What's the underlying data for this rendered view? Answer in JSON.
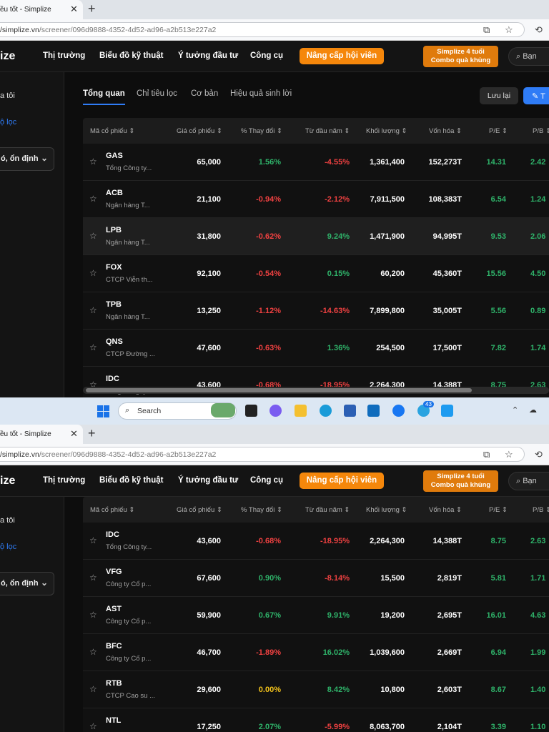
{
  "browser": {
    "tab_title": "ều tốt - Simplize",
    "tab_close": "✕",
    "new_tab": "+",
    "url_host": "/simplize.vn",
    "url_path": "/screener/096d9888-4352-4d52-ad96-a2b513e227a2"
  },
  "header": {
    "logo": "ize",
    "nav": [
      "Thị trường",
      "Biểu đồ kỹ thuật",
      "Ý tưởng đầu tư",
      "Công cụ"
    ],
    "upgrade": "Nâng cấp hội viên",
    "promo_line1": "Simplize 4 tuổi",
    "promo_line2": "Combo quà khủng",
    "search": "Bạn"
  },
  "sidebar": {
    "title": "a tôi",
    "link": "ộ lọc",
    "dropdown": "ó, ổn định"
  },
  "tabs": [
    "Tổng quan",
    "Chỉ tiêu lọc",
    "Cơ bản",
    "Hiệu quả sinh lời"
  ],
  "buttons": {
    "save": "Lưu lại",
    "create": "T"
  },
  "columns": [
    "Mã cổ phiếu ⇕",
    "Giá cổ phiếu ⇕",
    "% Thay đổi ⇕",
    "Từ đầu năm ⇕",
    "Khối lượng ⇕",
    "Vốn hóa ⇕",
    "P/E ⇕",
    "P/B ⇕"
  ],
  "rows_top": [
    {
      "sym": "GAS",
      "name": "Tổng Công ty...",
      "price": "65,000",
      "chg": "1.56%",
      "ytd": "-4.55%",
      "vol": "1,361,400",
      "cap": "152,273T",
      "pe": "14.31",
      "pb": "2.42"
    },
    {
      "sym": "ACB",
      "name": "Ngân hàng T...",
      "price": "21,100",
      "chg": "-0.94%",
      "ytd": "-2.12%",
      "vol": "7,911,500",
      "cap": "108,383T",
      "pe": "6.54",
      "pb": "1.24"
    },
    {
      "sym": "LPB",
      "name": "Ngân hàng T...",
      "price": "31,800",
      "chg": "-0.62%",
      "ytd": "9.24%",
      "vol": "1,471,900",
      "cap": "94,995T",
      "pe": "9.53",
      "pb": "2.06"
    },
    {
      "sym": "FOX",
      "name": "CTCP Viễn th...",
      "price": "92,100",
      "chg": "-0.54%",
      "ytd": "0.15%",
      "vol": "60,200",
      "cap": "45,360T",
      "pe": "15.56",
      "pb": "4.50"
    },
    {
      "sym": "TPB",
      "name": "Ngân hàng T...",
      "price": "13,250",
      "chg": "-1.12%",
      "ytd": "-14.63%",
      "vol": "7,899,800",
      "cap": "35,005T",
      "pe": "5.56",
      "pb": "0.89"
    },
    {
      "sym": "QNS",
      "name": "CTCP Đường ...",
      "price": "47,600",
      "chg": "-0.63%",
      "ytd": "1.36%",
      "vol": "254,500",
      "cap": "17,500T",
      "pe": "7.82",
      "pb": "1.74"
    },
    {
      "sym": "IDC",
      "name": "Tổng Công ty...",
      "price": "43,600",
      "chg": "-0.68%",
      "ytd": "-18.95%",
      "vol": "2,264,300",
      "cap": "14,388T",
      "pe": "8.75",
      "pb": "2.63"
    }
  ],
  "rows_bottom": [
    {
      "sym": "IDC",
      "name": "Tổng Công ty...",
      "price": "43,600",
      "chg": "-0.68%",
      "ytd": "-18.95%",
      "vol": "2,264,300",
      "cap": "14,388T",
      "pe": "8.75",
      "pb": "2.63"
    },
    {
      "sym": "VFG",
      "name": "Công ty Cổ p...",
      "price": "67,600",
      "chg": "0.90%",
      "ytd": "-8.14%",
      "vol": "15,500",
      "cap": "2,819T",
      "pe": "5.81",
      "pb": "1.71"
    },
    {
      "sym": "AST",
      "name": "Công ty Cổ p...",
      "price": "59,900",
      "chg": "0.67%",
      "ytd": "9.91%",
      "vol": "19,200",
      "cap": "2,695T",
      "pe": "16.01",
      "pb": "4.63"
    },
    {
      "sym": "BFC",
      "name": "Công ty Cổ p...",
      "price": "46,700",
      "chg": "-1.89%",
      "ytd": "16.02%",
      "vol": "1,039,600",
      "cap": "2,669T",
      "pe": "6.94",
      "pb": "1.99"
    },
    {
      "sym": "RTB",
      "name": "CTCP Cao su ...",
      "price": "29,600",
      "chg": "0.00%",
      "ytd": "8.42%",
      "vol": "10,800",
      "cap": "2,603T",
      "pe": "8.67",
      "pb": "1.40"
    },
    {
      "sym": "NTL",
      "name": "",
      "price": "17,250",
      "chg": "2.07%",
      "ytd": "-5.99%",
      "vol": "8,063,700",
      "cap": "2,104T",
      "pe": "3.39",
      "pb": "1.10"
    }
  ],
  "taskbar": {
    "search": "Search",
    "badge": "43"
  }
}
